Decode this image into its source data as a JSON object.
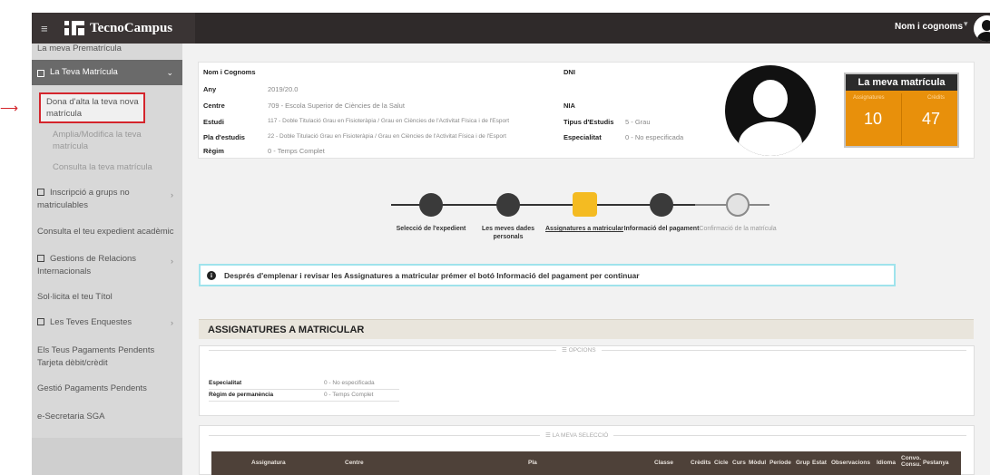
{
  "header": {
    "app_name": "TecnoCampus",
    "user_name": "Nom i cognoms"
  },
  "sidebar": {
    "items": [
      {
        "label": "La meva Prematrícula"
      },
      {
        "label": "La Teva Matrícula"
      },
      {
        "label": "Dona d'alta la teva nova matrícula"
      },
      {
        "label": "Amplia/Modifica la teva matrícula"
      },
      {
        "label": "Consulta la teva matrícula"
      },
      {
        "label": "Inscripció a grups no matriculables"
      },
      {
        "label": "Consulta el teu expedient acadèmic"
      },
      {
        "label": "Gestions de Relacions Internacionals"
      },
      {
        "label": "Sol·licita el teu Títol"
      },
      {
        "label": "Les Teves Enquestes"
      },
      {
        "label": "Els Teus Pagaments Pendents Tarjeta dèbit/crèdit"
      },
      {
        "label": "Gestió Pagaments Pendents"
      },
      {
        "label": "e-Secretaria SGA"
      }
    ]
  },
  "student": {
    "nom_label": "Nom i Cognoms",
    "any_label": "Any",
    "any_value": "2019/20.0",
    "centre_label": "Centre",
    "centre_value": "709 - Escola Superior de Ciències de la Salut",
    "estudi_label": "Estudi",
    "estudi_value": "117 - Doble Titulació Grau en Fisioteràpia / Grau en Ciències de l'Activitat Física i de l'Esport",
    "pla_label": "Pla d'estudis",
    "pla_value": "22 - Doble Titulació Grau en Fisioteràpia / Grau en Ciències de l'Activitat Física i de l'Esport",
    "regim_label": "Règim",
    "regim_value": "0 - Temps Complet",
    "dni_label": "DNI",
    "nia_label": "NIA",
    "tipus_label": "Tipus d'Estudis",
    "tipus_value": "5 - Grau",
    "especialitat_label": "Especialitat",
    "especialitat_value": "0 - No especificada"
  },
  "matricula_card": {
    "title": "La meva matrícula",
    "assignatures_label": "Assignatures",
    "assignatures_value": "10",
    "credits_label": "Crèdits",
    "credits_value": "47"
  },
  "steps": [
    {
      "label": "Selecció de l'expedient"
    },
    {
      "label": "Les meves dades personals"
    },
    {
      "label": "Assignatures a matricular"
    },
    {
      "label": "Informació del pagament"
    },
    {
      "label": "Confirmació de la matrícula"
    }
  ],
  "notice": "Després d'emplenar i revisar les Assignatures a matricular prémer el botó Informació del pagament per continuar",
  "section_title": "ASSIGNATURES A MATRICULAR",
  "opcions": {
    "legend": "☰ OPCIONS",
    "especialitat_label": "Especialitat",
    "especialitat_value": "0 - No especificada",
    "regim_label": "Règim de permanència",
    "regim_value": "0 - Temps Complet"
  },
  "seleccio": {
    "legend": "☰ LA MEVA SELECCIÓ",
    "columns": [
      "Assignatura",
      "Centre",
      "Pla",
      "Classe",
      "Crèdits",
      "Cicle",
      "Curs",
      "Mòdul",
      "Període",
      "Grup",
      "Estat",
      "Observacions",
      "Idioma",
      "Convo. Consu.",
      "Pestanya"
    ]
  }
}
